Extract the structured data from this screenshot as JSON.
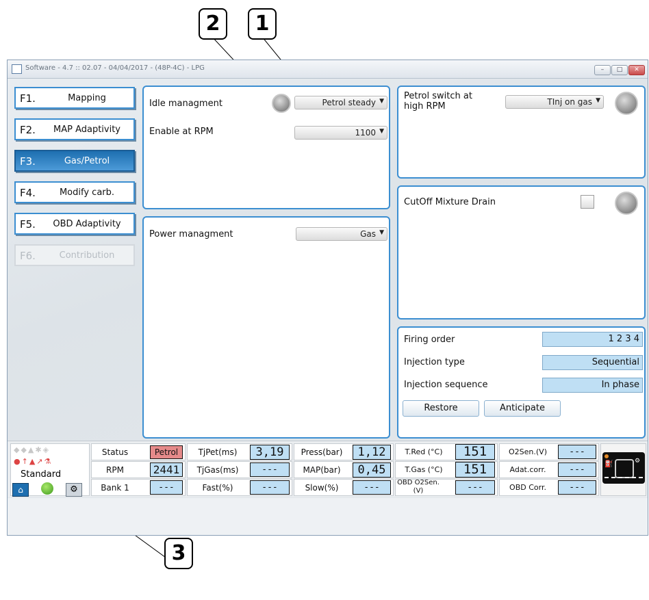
{
  "callouts": {
    "c1": "1",
    "c2": "2",
    "c3": "3"
  },
  "window": {
    "title": "Software - 4.7 :: 02.07 - 04/04/2017 - (48P-4C) - LPG",
    "buttons": [
      "minimize",
      "maximize",
      "close"
    ]
  },
  "menu": [
    {
      "key": "F1.",
      "label": "Mapping"
    },
    {
      "key": "F2.",
      "label": "MAP Adaptivity"
    },
    {
      "key": "F3.",
      "label": "Gas/Petrol"
    },
    {
      "key": "F4.",
      "label": "Modify carb."
    },
    {
      "key": "F5.",
      "label": "OBD Adaptivity"
    },
    {
      "key": "F6.",
      "label": "Contribution"
    }
  ],
  "idle": {
    "label": "Idle managment",
    "mode": "Petrol steady",
    "enable_label": "Enable at RPM",
    "enable_value": "1100"
  },
  "power": {
    "label": "Power managment",
    "value": "Gas"
  },
  "switch": {
    "label": "Petrol switch at high RPM",
    "value": "TInj on gas"
  },
  "cutoff": {
    "label": "CutOff Mixture Drain",
    "checked": false
  },
  "injection": {
    "firing_order_label": "Firing order",
    "firing_order": "1 2 3 4",
    "type_label": "Injection type",
    "type": "Sequential",
    "sequence_label": "Injection sequence",
    "sequence": "In phase",
    "restore": "Restore",
    "anticipate": "Anticipate"
  },
  "status_left": {
    "profile": "Standard"
  },
  "status": {
    "status_label": "Status",
    "status_value": "Petrol",
    "rpm_label": "RPM",
    "rpm_value": "2441",
    "bank_label": "Bank 1",
    "bank_value": "---",
    "tjpet_label": "TjPet(ms)",
    "tjpet_value": "3,19",
    "tjgas_label": "TjGas(ms)",
    "tjgas_value": "---",
    "fast_label": "Fast(%)",
    "fast_value": "---",
    "press_label": "Press(bar)",
    "press_value": "1,12",
    "map_label": "MAP(bar)",
    "map_value": "0,45",
    "slow_label": "Slow(%)",
    "slow_value": "---",
    "tred_label": "T.Red (°C)",
    "tred_value": "151",
    "tgas_label": "T.Gas (°C)",
    "tgas_value": "151",
    "obdo2_label": "OBD O2Sen.(V)",
    "obdo2_value": "---",
    "o2sen_label": "O2Sen.(V)",
    "o2sen_value": "---",
    "adat_label": "Adat.corr.",
    "adat_value": "---",
    "obdcorr_label": "OBD Corr.",
    "obdcorr_value": "---"
  },
  "colors": {
    "accent": "#3b8ed1",
    "field": "#bfdff4",
    "petrol": "#e58a8a",
    "active": "#1e6fb0"
  }
}
